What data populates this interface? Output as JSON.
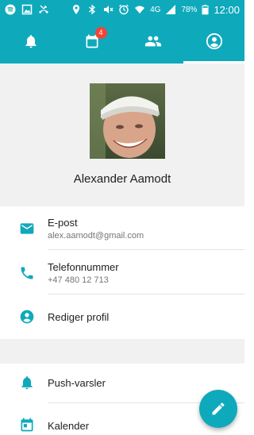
{
  "status_bar": {
    "battery_text": "78%",
    "time": "12:00",
    "network": "4G",
    "icons": [
      "spotify-icon",
      "image-icon",
      "missed-call-icon",
      "location-icon",
      "bluetooth-icon",
      "mute-icon",
      "alarm-icon",
      "wifi-icon",
      "signal-icon",
      "battery-icon"
    ]
  },
  "tabs": [
    {
      "name": "notifications",
      "icon": "bell-icon",
      "active": false
    },
    {
      "name": "calendar",
      "icon": "calendar-icon",
      "badge": "4",
      "active": false
    },
    {
      "name": "people",
      "icon": "people-icon",
      "active": false
    },
    {
      "name": "profile",
      "icon": "account-circle-icon",
      "active": true
    }
  ],
  "profile": {
    "name": "Alexander Aamodt"
  },
  "contact": {
    "email_label": "E-post",
    "email_value": "alex.aamodt@gmail.com",
    "phone_label": "Telefonnummer",
    "phone_value": "+47 480 12 713",
    "edit_label": "Rediger profil"
  },
  "settings": {
    "push_label": "Push-varsler",
    "calendar_label": "Kalender"
  },
  "colors": {
    "primary": "#0fa9bc",
    "badge": "#f44336",
    "header_bg": "#f1f1f1"
  }
}
